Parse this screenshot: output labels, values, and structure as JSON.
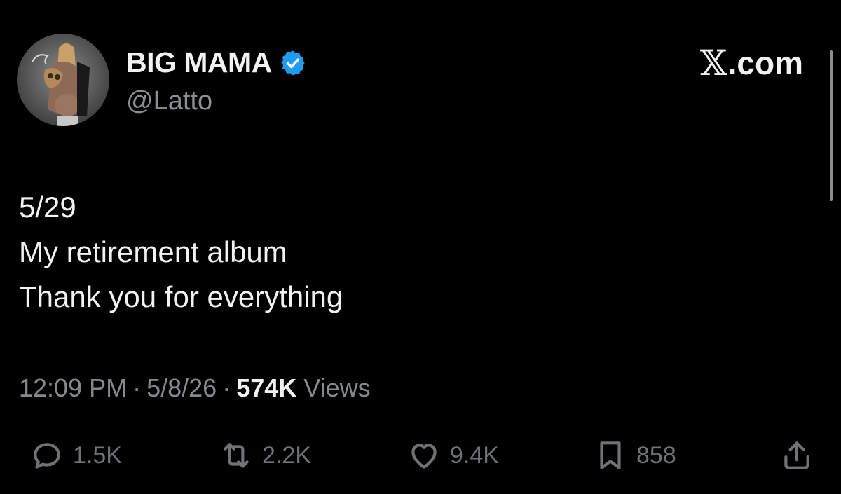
{
  "user": {
    "display_name": "BIG MAMA",
    "handle": "@Latto",
    "verified": true,
    "avatar_icon": "profile-photo"
  },
  "brand": {
    "x": "𝕏",
    "text": ".com"
  },
  "tweet": {
    "lines": [
      "5/29",
      "My retirement album",
      "Thank you for everything"
    ]
  },
  "meta": {
    "time": "12:09 PM",
    "separator": "·",
    "date": "5/8/26",
    "views_count": "574K",
    "views_label": "Views"
  },
  "actions": {
    "replies": {
      "icon": "reply-icon",
      "count": "1.5K"
    },
    "reposts": {
      "icon": "repost-icon",
      "count": "2.2K"
    },
    "likes": {
      "icon": "heart-icon",
      "count": "9.4K"
    },
    "bookmarks": {
      "icon": "bookmark-icon",
      "count": "858"
    },
    "share": {
      "icon": "share-icon"
    }
  },
  "colors": {
    "background": "#000000",
    "verified_badge": "#1d9bf0",
    "secondary_text": "#85898e",
    "icon_gray": "#6e7378"
  }
}
